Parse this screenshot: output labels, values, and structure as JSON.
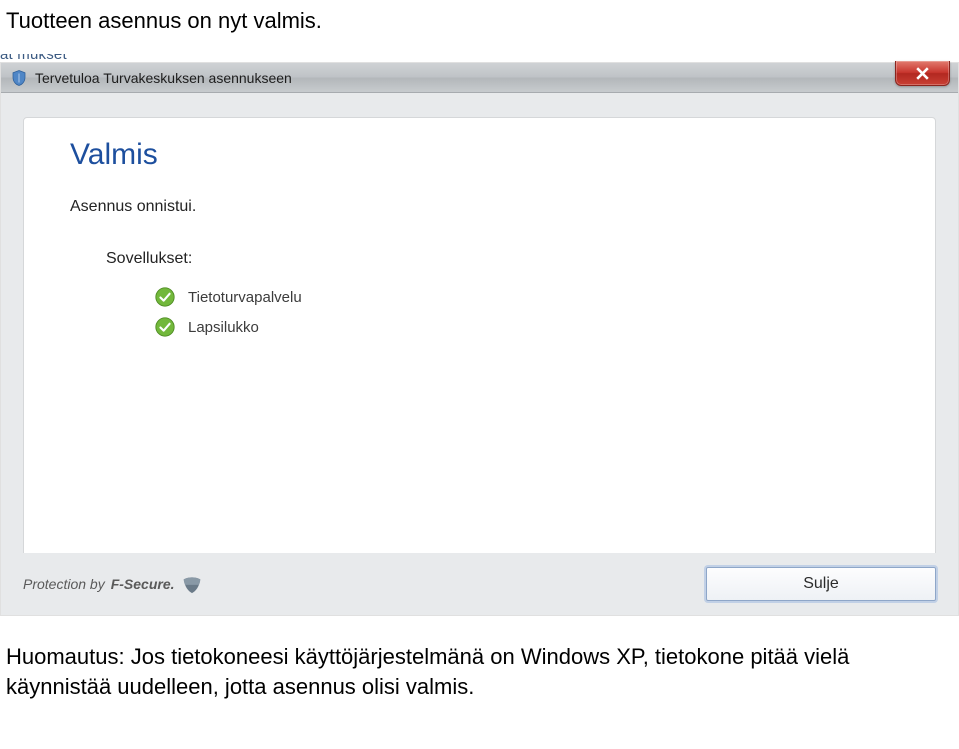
{
  "doc": {
    "intro": "Tuotteen asennus on nyt valmis.",
    "note": "Huomautus: Jos tietokoneesi käyttöjärjestelmänä on Windows XP, tietokone pitää vielä käynnistää uudelleen, jotta asennus olisi valmis."
  },
  "window": {
    "titlebar": "Tervetuloa Turvakeskuksen asennukseen",
    "close_label": "Close",
    "heading": "Valmis",
    "subtext": "Asennus onnistui.",
    "apps_label": "Sovellukset:",
    "apps": [
      "Tietoturvapalvelu",
      "Lapsilukko"
    ],
    "footer": {
      "protection_prefix": "Protection by",
      "brand": "F-Secure.",
      "close_button": "Sulje"
    }
  }
}
